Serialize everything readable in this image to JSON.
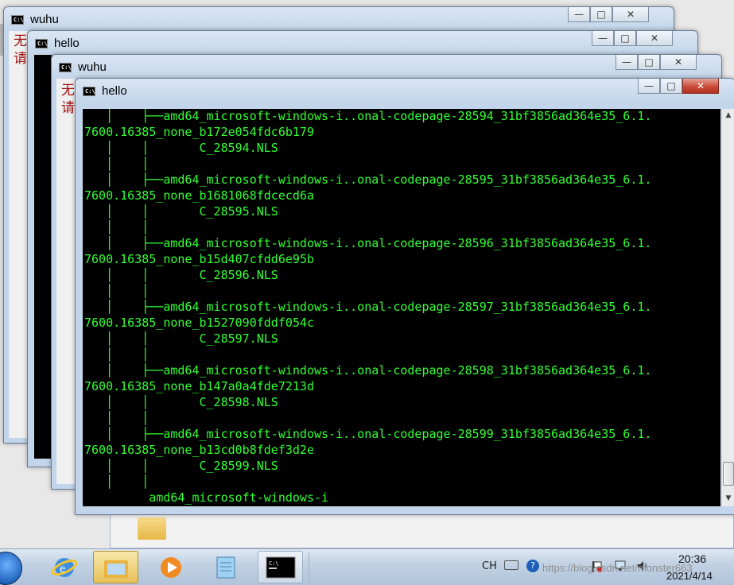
{
  "windows": [
    {
      "title": "wuhu",
      "side_text": [
        "无",
        "请"
      ]
    },
    {
      "title": "hello"
    },
    {
      "title": "wuhu",
      "side_text": [
        "无",
        "请"
      ]
    },
    {
      "title": "hello"
    }
  ],
  "controls": {
    "minimize": "—",
    "maximize": "□",
    "close": "✕"
  },
  "console_lines": [
    "   │    ├──amd64_microsoft-windows-i..onal-codepage-28594_31bf3856ad364e35_6.1.",
    "7600.16385_none_b172e054fdc6b179",
    "   │    │       C_28594.NLS",
    "   │    │",
    "   │    ├──amd64_microsoft-windows-i..onal-codepage-28595_31bf3856ad364e35_6.1.",
    "7600.16385_none_b1681068fdcecd6a",
    "   │    │       C_28595.NLS",
    "   │    │",
    "   │    ├──amd64_microsoft-windows-i..onal-codepage-28596_31bf3856ad364e35_6.1.",
    "7600.16385_none_b15d407cfdd6e95b",
    "   │    │       C_28596.NLS",
    "   │    │",
    "   │    ├──amd64_microsoft-windows-i..onal-codepage-28597_31bf3856ad364e35_6.1.",
    "7600.16385_none_b1527090fddf054c",
    "   │    │       C_28597.NLS",
    "   │    │",
    "   │    ├──amd64_microsoft-windows-i..onal-codepage-28598_31bf3856ad364e35_6.1.",
    "7600.16385_none_b147a0a4fde7213d",
    "   │    │       C_28598.NLS",
    "   │    │",
    "   │    ├──amd64_microsoft-windows-i..onal-codepage-28599_31bf3856ad364e35_6.1.",
    "7600.16385_none_b13cd0b8fdef3d2e",
    "   │    │       C_28599.NLS",
    "   │    │",
    "         amd64_microsoft-windows-i"
  ],
  "taskbar": {
    "ime": "CH",
    "time": "20:36",
    "date": "2021/4/14",
    "watermark": "https://blog.csdn.net/monster663"
  },
  "colors": {
    "console_bg": "#000000",
    "console_text": "#33ff33",
    "close_active": "#c74634"
  },
  "icons": [
    "cmd-icon",
    "start-orb-icon",
    "ie-icon",
    "explorer-icon",
    "media-player-icon",
    "notepad-icon",
    "keyboard-icon",
    "help-icon",
    "flag-icon",
    "network-icon",
    "volume-icon"
  ]
}
